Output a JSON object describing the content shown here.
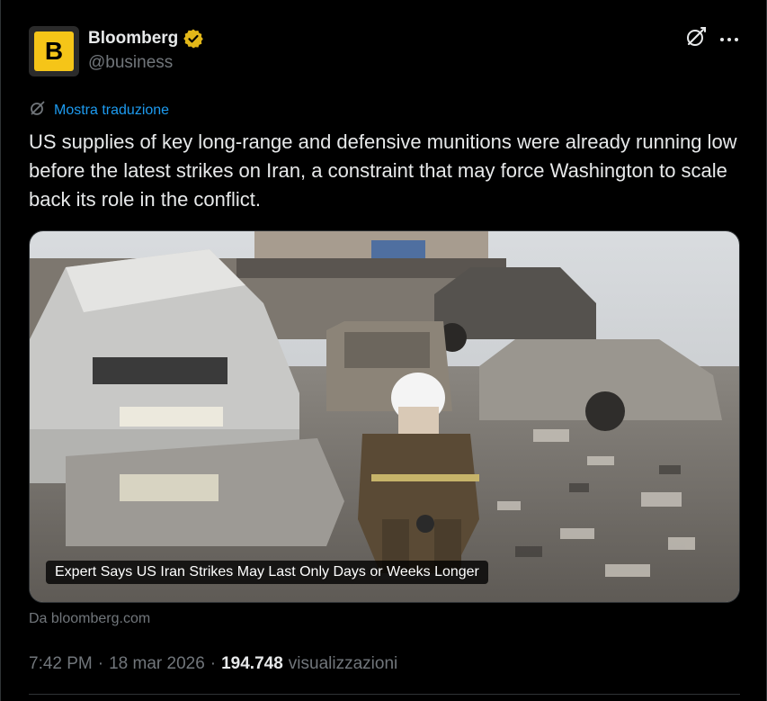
{
  "author": {
    "name": "Bloomberg",
    "handle": "@business",
    "avatar_letter": "B",
    "avatar_color": "#f5c518",
    "verified_badge_color": "#e2b719"
  },
  "actions": {
    "grok_icon": "grok-icon",
    "more_icon": "more-horizontal-icon"
  },
  "translate_label": "Mostra traduzione",
  "tweet_text": "US supplies of key long-range and defensive munitions were already running low before the latest strikes on Iran, a constraint that may force Washington to scale back its role in the conflict.",
  "media": {
    "card_title": "Expert Says US Iran Strikes May Last Only Days or Weeks Longer",
    "source": "Da bloomberg.com"
  },
  "meta": {
    "time": "7:42 PM",
    "separator": "·",
    "date": "18 mar 2026",
    "views_count": "194.748",
    "views_label": "visualizzazioni"
  },
  "colors": {
    "background": "#000000",
    "text_primary": "#e7e9ea",
    "text_secondary": "#71767b",
    "link": "#1d9bf0"
  }
}
